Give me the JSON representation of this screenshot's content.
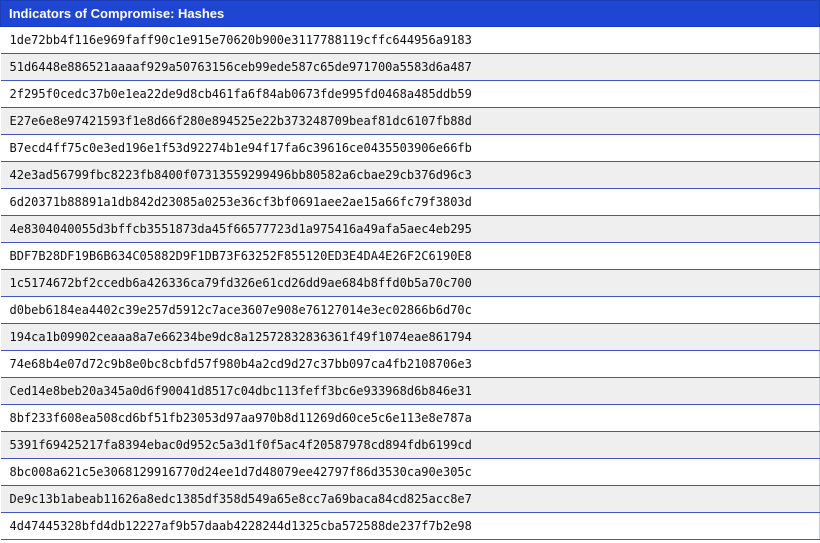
{
  "table": {
    "title": "Indicators of Compromise: Hashes",
    "hashes": [
      "1de72bb4f116e969faff90c1e915e70620b900e3117788119cffc644956a9183",
      "51d6448e886521aaaaf929a50763156ceb99ede587c65de971700a5583d6a487",
      "2f295f0cedc37b0e1ea22de9d8cb461fa6f84ab0673fde995fd0468a485ddb59",
      "E27e6e8e97421593f1e8d66f280e894525e22b373248709beaf81dc6107fb88d",
      "B7ecd4ff75c0e3ed196e1f53d92274b1e94f17fa6c39616ce0435503906e66fb",
      "42e3ad56799fbc8223fb8400f07313559299496bb80582a6cbae29cb376d96c3",
      "6d20371b88891a1db842d23085a0253e36cf3bf0691aee2ae15a66fc79f3803d",
      "4e8304040055d3bffcb3551873da45f66577723d1a975416a49afa5aec4eb295",
      "BDF7B28DF19B6B634C05882D9F1DB73F63252F855120ED3E4DA4E26F2C6190E8",
      "1c5174672bf2ccedb6a426336ca79fd326e61cd26dd9ae684b8ffd0b5a70c700",
      "d0beb6184ea4402c39e257d5912c7ace3607e908e76127014e3ec02866b6d70c",
      "194ca1b09902ceaaa8a7e66234be9dc8a12572832836361f49f1074eae861794",
      "74e68b4e07d72c9b8e0bc8cbfd57f980b4a2cd9d27c37bb097ca4fb2108706e3",
      "Ced14e8beb20a345a0d6f90041d8517c04dbc113feff3bc6e933968d6b846e31",
      "8bf233f608ea508cd6bf51fb23053d97aa970b8d11269d60ce5c6e113e8e787a",
      "5391f69425217fa8394ebac0d952c5a3d1f0f5ac4f20587978cd894fdb6199cd",
      "8bc008a621c5e3068129916770d24ee1d7d48079ee42797f86d3530ca90e305c",
      "De9c13b1abeab11626a8edc1385df358d549a65e8cc7a69baca84cd825acc8e7",
      "4d47445328bfd4db12227af9b57daab4228244d1325cba572588de237f7b2e98"
    ]
  }
}
